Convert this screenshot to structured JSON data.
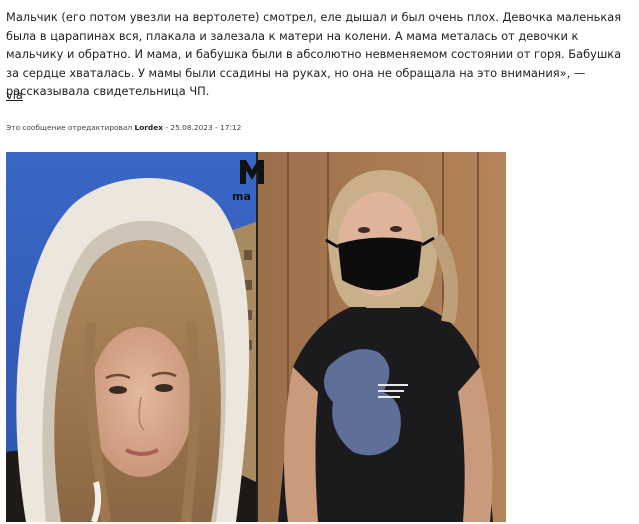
{
  "post": {
    "paragraph": "Мальчик (его потом увезли на вертолете) смотрел, еле дышал и был очень плох. Девочка маленькая была в царапинах вся, плакала и залезала к матери на колени. А мама металась от девочки к мальчику и обратно. И мама, и бабушка были в абсолютно невменяемом состоянии от горя. Бабушка за сердце хваталась. У мамы были ссадины на руках, но она не обращала на это внимания», — рассказывала свидетельница ЧП.",
    "via_label": "via",
    "edit_prefix": "Это сообщение отредактировал",
    "edit_author": "Lordex",
    "edit_suffix": "- 25.08.2023 - 17:12"
  },
  "photos": {
    "left_icon": "woman-in-hood-selfie",
    "right_icon": "woman-in-black-mask",
    "watermark": "ma"
  },
  "colors": {
    "text": "#222222",
    "page_bg": "#ffffff"
  }
}
